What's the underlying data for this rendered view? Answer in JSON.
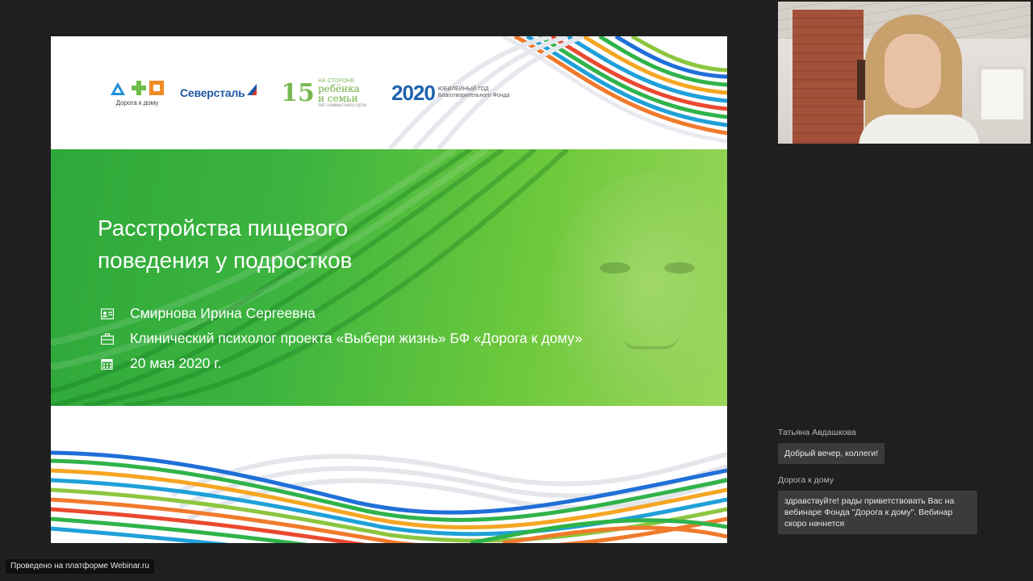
{
  "slide": {
    "logos": {
      "doroga": "Дорога к дому",
      "severstal": "Северсталь",
      "fifteen": {
        "number": "15",
        "line1": "НА СТОРОНЕ",
        "line2": "ребёнка",
        "line3": "и семьи",
        "line4": "лет совместного пути"
      },
      "year": {
        "number": "2020",
        "line1": "ЮБИЛЕЙНЫЙ ГОД",
        "line2": "Благотворительного Фонда"
      }
    },
    "title_line1": "Расстройства пищевого",
    "title_line2": "поведения у подростков",
    "info": {
      "name": "Смирнова Ирина Сергеевна",
      "position": "Клинический психолог проекта «Выбери жизнь» БФ «Дорога к дому»",
      "date": "20 мая 2020 г."
    },
    "icons": [
      "id-card-icon",
      "briefcase-icon",
      "calendar-icon"
    ]
  },
  "chat": {
    "messages": [
      {
        "author": "Татьяна Авдашкова",
        "text": "Добрый вечер, коллеги!"
      },
      {
        "author": "Дорога к дому",
        "text": "здравствуйте! рады приветствовать Вас на вебинаре Фонда \"Дорога к дому\". Вебинар скоро начнется"
      }
    ]
  },
  "footer": {
    "badge": "Проведено на платформе Webinar.ru"
  },
  "colors": {
    "background": "#1f1f1f",
    "slide_green": "#3cb43f",
    "bubble": "#3b3b3b"
  }
}
